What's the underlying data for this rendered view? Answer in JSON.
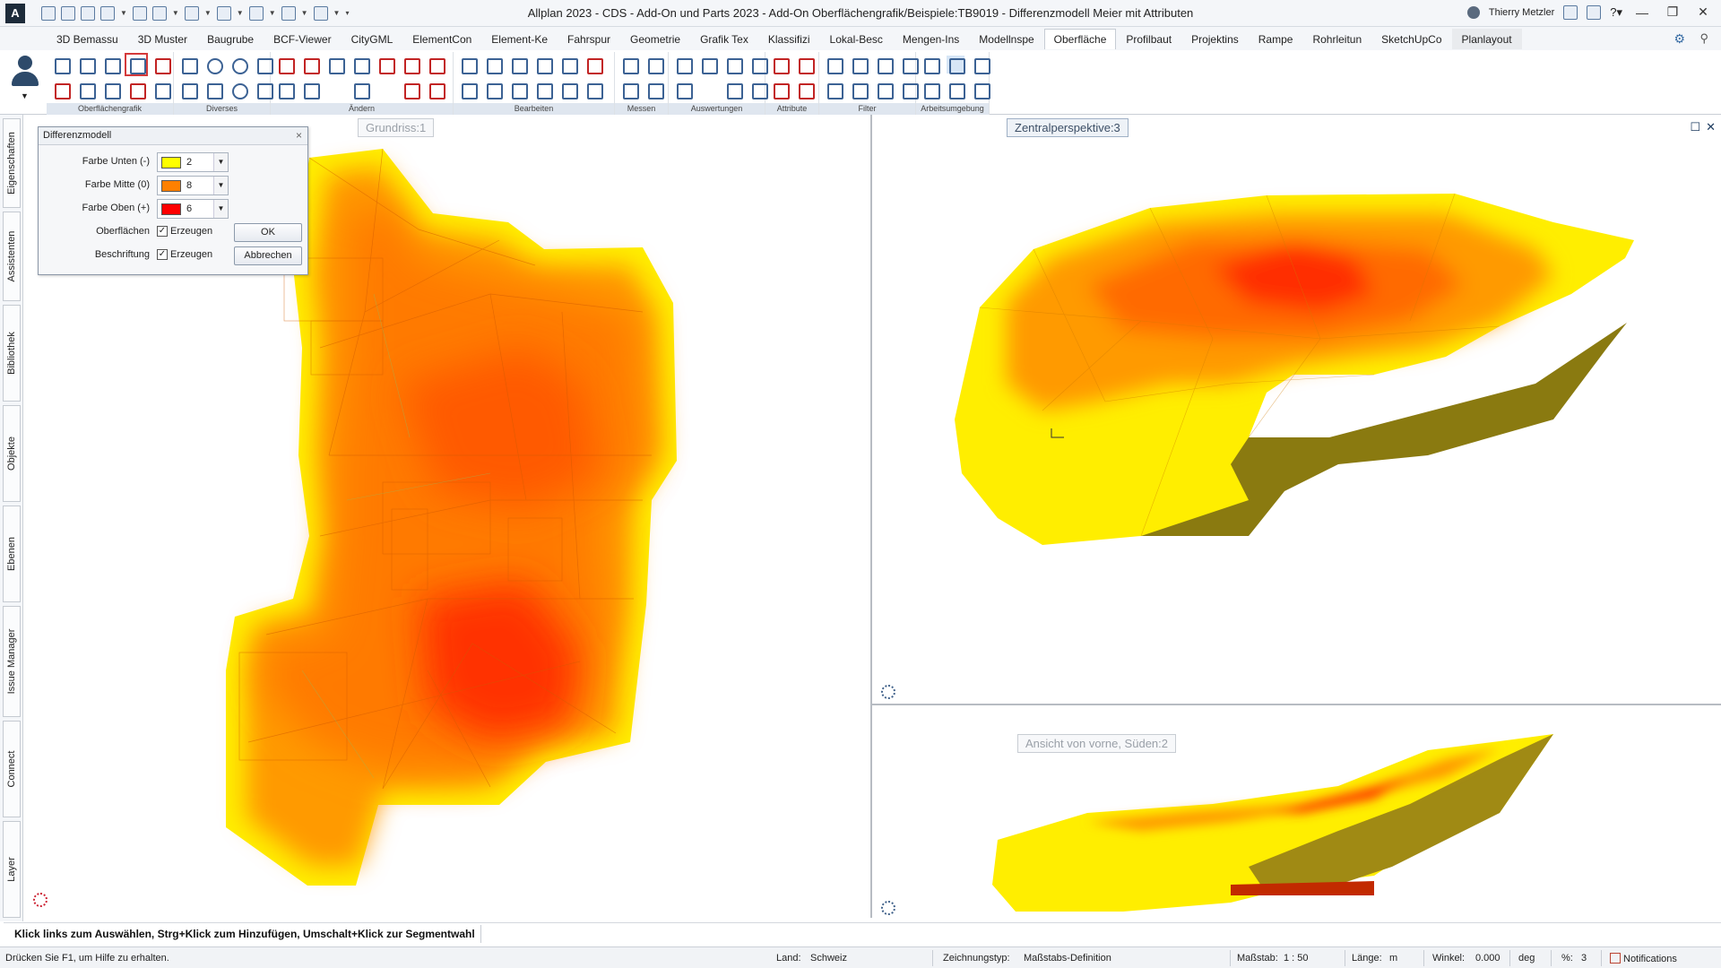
{
  "window": {
    "title": "Allplan 2023 - CDS - Add-On und Parts 2023 - Add-On Oberflächengrafik/Beispiele:TB9019 - Differenzmodell Meier mit Attributen",
    "user": "Thierry Metzler",
    "app_icon": "A"
  },
  "tabs": [
    {
      "label": "3D Bemassu"
    },
    {
      "label": "3D Muster"
    },
    {
      "label": "Baugrube"
    },
    {
      "label": "BCF-Viewer"
    },
    {
      "label": "CityGML"
    },
    {
      "label": "ElementCon"
    },
    {
      "label": "Element-Ke"
    },
    {
      "label": "Fahrspur"
    },
    {
      "label": "Geometrie"
    },
    {
      "label": "Grafik Tex"
    },
    {
      "label": "Klassifizi"
    },
    {
      "label": "Lokal-Besc"
    },
    {
      "label": "Mengen-Ins"
    },
    {
      "label": "Modellnspe"
    },
    {
      "label": "Oberfläche"
    },
    {
      "label": "Profilbaut"
    },
    {
      "label": "Projektins"
    },
    {
      "label": "Rampe"
    },
    {
      "label": "Rohrleitun"
    },
    {
      "label": "SketchUpCo"
    },
    {
      "label": "Planlayout"
    }
  ],
  "active_tab": "Oberfläche",
  "ribbon_groups": [
    {
      "label": "Oberflächengrafik"
    },
    {
      "label": "Diverses"
    },
    {
      "label": "Ändern"
    },
    {
      "label": "Bearbeiten"
    },
    {
      "label": "Messen"
    },
    {
      "label": "Auswertungen"
    },
    {
      "label": "Attribute"
    },
    {
      "label": "Filter"
    },
    {
      "label": "Arbeitsumgebung"
    }
  ],
  "side_tabs": [
    "Eigenschaften",
    "Assistenten",
    "Bibliothek",
    "Objekte",
    "Ebenen",
    "Issue Manager",
    "Connect",
    "Layer"
  ],
  "viewports": {
    "left": {
      "title": "Grundriss:1"
    },
    "right_top": {
      "title": "Zentralperspektive:3"
    },
    "right_bottom": {
      "title": "Ansicht von vorne, Süden:2"
    }
  },
  "dialog": {
    "title": "Differenzmodell",
    "rows": [
      {
        "label": "Farbe Unten (-)",
        "value": "2",
        "color": "#ffff00"
      },
      {
        "label": "Farbe Mitte (0)",
        "value": "8",
        "color": "#ff8000"
      },
      {
        "label": "Farbe Oben (+)",
        "value": "6",
        "color": "#ff0000"
      }
    ],
    "oberflaechen_label": "Oberflächen",
    "beschriftung_label": "Beschriftung",
    "checkbox_text": "Erzeugen",
    "ok": "OK",
    "cancel": "Abbrechen"
  },
  "hint": "Klick links zum Auswählen, Strg+Klick zum Hinzufügen, Umschalt+Klick zur Segmentwahl",
  "status": {
    "help": "Drücken Sie F1, um Hilfe zu erhalten.",
    "land_label": "Land:",
    "land_value": "Schweiz",
    "zeich_label": "Zeichnungstyp:",
    "zeich_value": "Maßstabs-Definition",
    "massstab_label": "Maßstab:",
    "massstab_value": "1 : 50",
    "laenge_label": "Länge:",
    "laenge_value": "m",
    "winkel_label": "Winkel:",
    "winkel_value": "0.000",
    "winkel_unit": "deg",
    "percent_label": "%:",
    "percent_value": "3",
    "notifications": "Notifications"
  },
  "colors": {
    "yellow": "#ffee00",
    "orange": "#ff8a00",
    "red": "#ff2200",
    "accent": "#3c6294"
  }
}
